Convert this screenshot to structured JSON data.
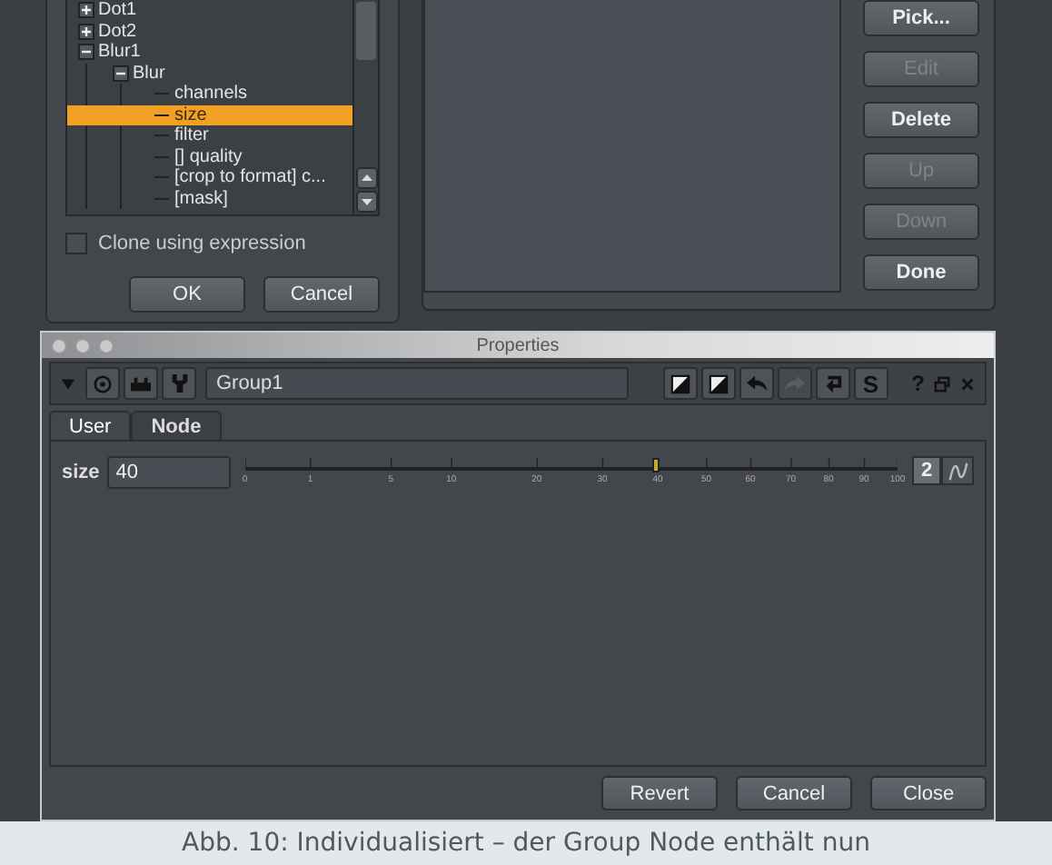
{
  "pick_dialog": {
    "tree": [
      {
        "label": "Dot1",
        "expanded": false,
        "selected": false
      },
      {
        "label": "Dot2",
        "expanded": false,
        "selected": false
      },
      {
        "label": "Blur1",
        "expanded": true,
        "selected": false,
        "children": [
          {
            "label": "Blur",
            "expanded": true,
            "selected": false,
            "children": [
              {
                "label": "channels",
                "selected": false
              },
              {
                "label": "size",
                "selected": true
              },
              {
                "label": "filter",
                "selected": false
              },
              {
                "label": "[] quality",
                "selected": false
              },
              {
                "label": "[crop to format] c...",
                "selected": false
              },
              {
                "label": "[mask]",
                "selected": false
              }
            ]
          }
        ]
      }
    ],
    "clone_checkbox": {
      "label": "Clone using expression",
      "checked": false
    },
    "buttons": [
      {
        "label": "OK"
      },
      {
        "label": "Cancel"
      }
    ]
  },
  "knob_panel": {
    "buttons": [
      {
        "label": "Pick...",
        "disabled": false
      },
      {
        "label": "Edit",
        "disabled": true
      },
      {
        "label": "Delete",
        "disabled": false
      },
      {
        "label": "Up",
        "disabled": true
      },
      {
        "label": "Down",
        "disabled": true
      },
      {
        "label": "Done",
        "disabled": false
      }
    ]
  },
  "properties": {
    "window_title": "Properties",
    "node_name": "Group1",
    "toolbar": [
      {
        "kind": "split",
        "disabled": false
      },
      {
        "kind": "split",
        "disabled": false
      },
      {
        "kind": "undo",
        "disabled": false
      },
      {
        "kind": "redo",
        "disabled": true
      },
      {
        "kind": "revert",
        "disabled": false
      },
      {
        "kind": "letter",
        "text": "S",
        "disabled": false
      }
    ],
    "help": "?",
    "tabs": [
      {
        "label": "User",
        "selected": true
      },
      {
        "label": "Node",
        "selected": false
      }
    ],
    "knob": {
      "label": "size",
      "value": "40",
      "level": 0.63,
      "ticks": [
        "0",
        "1",
        "5",
        "10",
        "20",
        "30",
        "40",
        "50",
        "60",
        "70",
        "80",
        "90",
        "100"
      ],
      "channels": "2"
    },
    "buttons": [
      {
        "label": "Revert"
      },
      {
        "label": "Cancel"
      },
      {
        "label": "Close"
      }
    ]
  },
  "caption": "Abb. 10: Individualisiert – der Group Node enthält nun"
}
